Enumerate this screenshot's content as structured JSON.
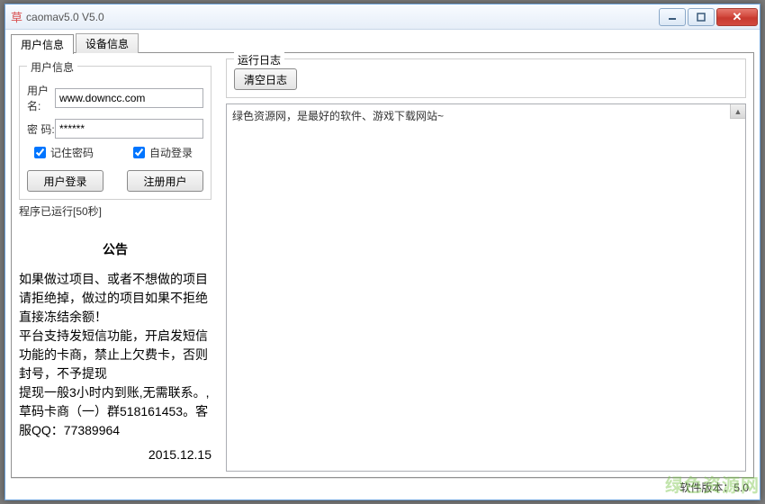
{
  "window": {
    "icon": "草",
    "title": "caomav5.0 V5.0"
  },
  "tabs": {
    "user_info": "用户信息",
    "device_info": "设备信息"
  },
  "login_group": {
    "legend": "用户信息",
    "username_label": "用户名:",
    "username_value": "www.downcc.com",
    "password_label": "密   码:",
    "password_value": "******",
    "remember_label": "记住密码",
    "autologin_label": "自动登录",
    "login_btn": "用户登录",
    "register_btn": "注册用户"
  },
  "status_text": "程序已运行[50秒]",
  "notice": {
    "title": "公告",
    "body": "如果做过项目、或者不想做的项目请拒绝掉，做过的项目如果不拒绝直接冻结余额！\n平台支持发短信功能，开启发短信功能的卡商，禁止上欠费卡，否则封号，不予提现\n提现一般3小时内到账,无需联系。,\n草码卡商（一）群518161453。客服QQ：77389964",
    "date": "2015.12.15"
  },
  "log": {
    "legend": "运行日志",
    "clear_btn": "清空日志",
    "content": "绿色资源网，是最好的软件、游戏下载网站~"
  },
  "footer": {
    "version_label": "软件版本：5.0"
  },
  "watermark": "绿色资源网"
}
